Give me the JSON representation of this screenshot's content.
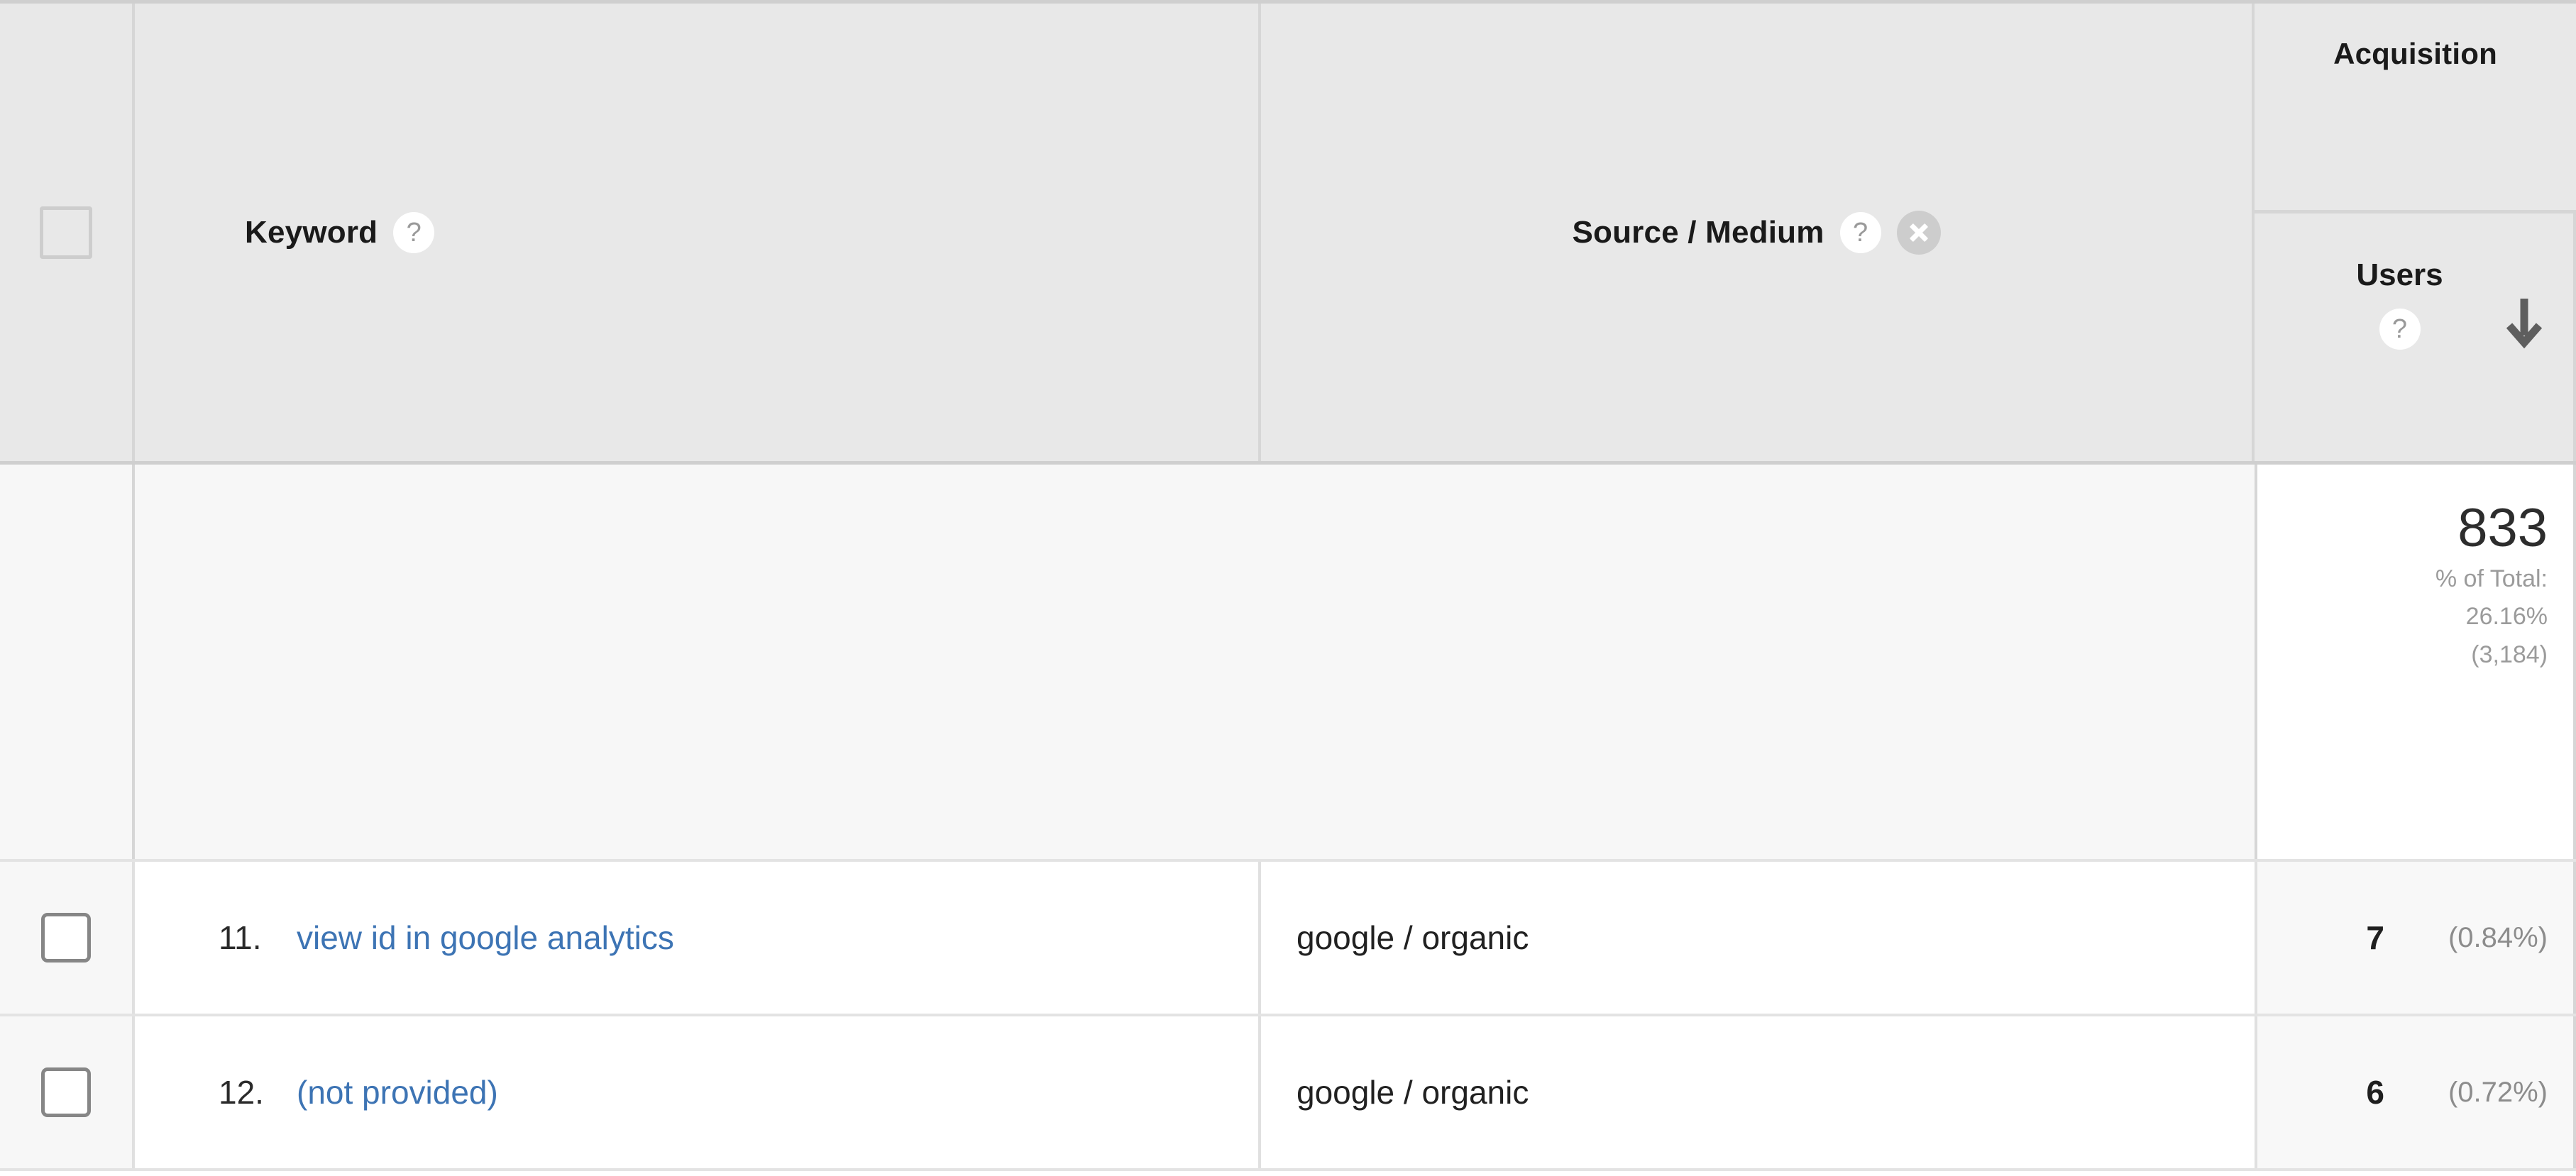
{
  "table": {
    "header": {
      "checkbox_select_all": "",
      "keyword_label": "Keyword",
      "source_medium_label": "Source / Medium",
      "acquisition_label": "Acquisition",
      "users_label": "Users",
      "help_icon": "?",
      "remove_icon": "remove-dimension",
      "sort_direction": "descending"
    },
    "summary": {
      "users_total": "833",
      "percent_of_total_label": "% of Total:",
      "percent_of_total_value": "26.16%",
      "grand_total": "(3,184)"
    },
    "columns": [
      "",
      "Keyword",
      "Source / Medium",
      "Users"
    ],
    "rows": [
      {
        "index": "11.",
        "keyword": "view id in google analytics",
        "source_medium": "google / organic",
        "users": "7",
        "users_pct": "(0.84%)"
      },
      {
        "index": "12.",
        "keyword": "(not provided)",
        "source_medium": "google / organic",
        "users": "6",
        "users_pct": "(0.72%)"
      }
    ]
  },
  "colors": {
    "link": "#3d74b4",
    "header_bg": "#e8e8e8",
    "summary_bg": "#f7f7f7",
    "muted_text": "#9b9b9b"
  }
}
